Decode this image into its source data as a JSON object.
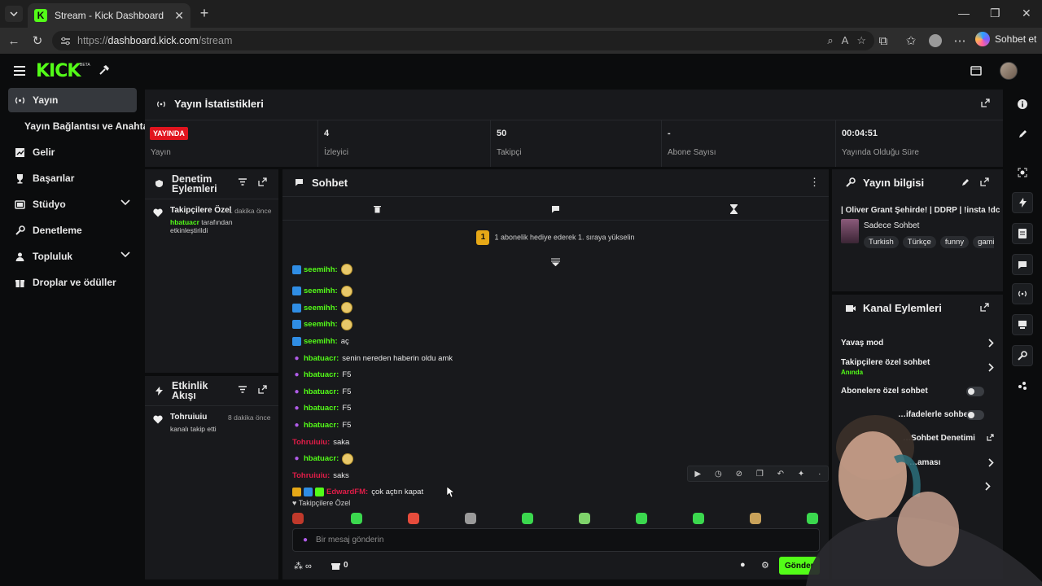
{
  "browser": {
    "tab_title": "Stream - Kick Dashboard",
    "url_prefix": "https://",
    "url_host": "dashboard.kick.com",
    "url_path": "/stream",
    "copilot_label": "Sohbet et"
  },
  "header": {
    "logo": "KICK",
    "beta": "BETA"
  },
  "sidebar": {
    "items": [
      {
        "label": "Yayın",
        "icon": "broadcast-icon",
        "active": true
      },
      {
        "label": "Yayın Bağlantısı ve Anahtarı",
        "icon": "",
        "active": false
      },
      {
        "label": "Gelir",
        "icon": "chart-icon",
        "active": false
      },
      {
        "label": "Başarılar",
        "icon": "trophy-icon",
        "active": false
      },
      {
        "label": "Stüdyo",
        "icon": "studio-icon",
        "active": false,
        "expandable": true
      },
      {
        "label": "Denetleme",
        "icon": "wrench-icon",
        "active": false
      },
      {
        "label": "Topluluk",
        "icon": "community-icon",
        "active": false,
        "expandable": true
      },
      {
        "label": "Droplar ve ödüller",
        "icon": "gift-icon",
        "active": false
      }
    ]
  },
  "stats": {
    "title": "Yayın İstatistikleri",
    "live_badge": "YAYINDA",
    "items": [
      {
        "value": "",
        "label": "Yayın"
      },
      {
        "value": "4",
        "label": "İzleyici"
      },
      {
        "value": "50",
        "label": "Takipçi"
      },
      {
        "value": "-",
        "label": "Abone Sayısı"
      },
      {
        "value": "00:04:51",
        "label": "Yayında Olduğu Süre"
      }
    ]
  },
  "moderation": {
    "title_line1": "Denetim",
    "title_line2": "Eylemleri",
    "item": {
      "title": "Takipçilere Özel",
      "time": "1 dakika önce",
      "actor": "hbatuacr",
      "text": "tarafından etkinleştirildi"
    }
  },
  "activity": {
    "title_line1": "Etkinlik",
    "title_line2": "Akışı",
    "item": {
      "name": "Tohruiuiu",
      "time": "8 dakika önce",
      "text": "kanalı takip etti"
    }
  },
  "chat": {
    "title": "Sohbet",
    "notice": "1 abonelik hediye ederek 1. sıraya yükselin",
    "notice_rank": "1",
    "messages": [
      {
        "user": "seemihh",
        "text": "",
        "color": "green",
        "badge": "blue",
        "emote": true
      },
      {
        "user": "seemihh",
        "text": "",
        "color": "green",
        "badge": "blue",
        "emote": true
      },
      {
        "user": "seemihh",
        "text": "",
        "color": "green",
        "badge": "blue",
        "emote": true
      },
      {
        "user": "seemihh",
        "text": "",
        "color": "green",
        "badge": "blue",
        "emote": true
      },
      {
        "user": "seemihh",
        "text": "aç",
        "color": "green",
        "badge": "blue",
        "emote": false
      },
      {
        "user": "hbatuacr",
        "text": "senin nereden haberin oldu amk",
        "color": "green",
        "badge": "mic",
        "emote": false
      },
      {
        "user": "hbatuacr",
        "text": "F5",
        "color": "green",
        "badge": "mic",
        "emote": false
      },
      {
        "user": "hbatuacr",
        "text": "F5",
        "color": "green",
        "badge": "mic",
        "emote": false
      },
      {
        "user": "hbatuacr",
        "text": "F5",
        "color": "green",
        "badge": "mic",
        "emote": false
      },
      {
        "user": "hbatuacr",
        "text": "F5",
        "color": "green",
        "badge": "mic",
        "emote": false
      },
      {
        "user": "Tohruiuiu",
        "text": "saka",
        "color": "red",
        "badge": "",
        "emote": false
      },
      {
        "user": "hbatuacr",
        "text": "",
        "color": "green",
        "badge": "mic",
        "emote": true
      },
      {
        "user": "Tohruiuiu",
        "text": "saks",
        "color": "red",
        "badge": "",
        "emote": false
      },
      {
        "user": "EdwardFM",
        "text": "çok açtın kapat",
        "color": "red",
        "badge": "multi",
        "emote": false
      }
    ],
    "followers_only": "Takipçilere Özel",
    "input_placeholder": "Bir mesaj gönderin",
    "points_label": "0",
    "send_label": "Gönder"
  },
  "info": {
    "title": "Yayın bilgisi",
    "stream_title": "| Oliver Grant Şehirde! | DDRP | !insta !dc",
    "category": "Sadece Sohbet",
    "tags": [
      "Turkish",
      "Türkçe",
      "funny",
      "gaming"
    ]
  },
  "actions": {
    "title": "Kanal Eylemleri",
    "rows": [
      {
        "label": "Yavaş mod",
        "sub": "",
        "control": "chevron"
      },
      {
        "label": "Takipçilere özel sohbet",
        "sub": "Anında",
        "control": "chevron"
      },
      {
        "label": "Abonelere özel sohbet",
        "sub": "",
        "control": "toggle"
      },
      {
        "label": "…ifadelerle sohbet",
        "sub": "",
        "control": "toggle"
      },
      {
        "label": "…Sohbet Denetimi",
        "sub": "",
        "control": "external"
      },
      {
        "label": "…aması",
        "sub": "",
        "control": "chevron"
      }
    ]
  }
}
